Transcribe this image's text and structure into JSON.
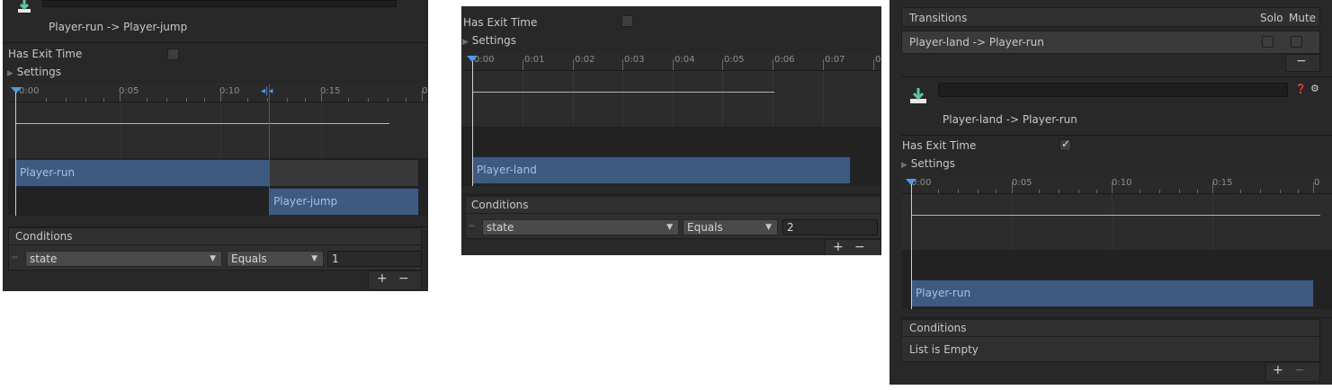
{
  "panel1": {
    "title": "Player-run -> Player-jump",
    "has_exit_time_label": "Has Exit Time",
    "settings_label": "Settings",
    "ticks": [
      "0:00",
      "0:05",
      "0:10",
      "0:15",
      "0"
    ],
    "bar1_label": "Player-run",
    "bar2_label": "Player-jump",
    "conditions_label": "Conditions",
    "condition_param": "state",
    "condition_op": "Equals",
    "condition_value": "1",
    "plus": "+",
    "minus": "−"
  },
  "panel2": {
    "has_exit_time_label": "Has Exit Time",
    "settings_label": "Settings",
    "ticks": [
      "0:00",
      "0:01",
      "0:02",
      "0:03",
      "0:04",
      "0:05",
      "0:06",
      "0:07",
      "0"
    ],
    "bar_label": "Player-land",
    "conditions_label": "Conditions",
    "condition_param": "state",
    "condition_op": "Equals",
    "condition_value": "2",
    "plus": "+",
    "minus": "−"
  },
  "panel3": {
    "transitions_header": "Transitions",
    "solo_label": "Solo",
    "mute_label": "Mute",
    "transition_row": "Player-land -> Player-run",
    "minus_small": "−",
    "title": "Player-land -> Player-run",
    "has_exit_time_label": "Has Exit Time",
    "has_exit_time_check": "✓",
    "settings_label": "Settings",
    "ticks": [
      "0:00",
      "0:05",
      "0:10",
      "0:15",
      "0"
    ],
    "bar_label": "Player-run",
    "conditions_label": "Conditions",
    "list_empty": "List is Empty",
    "plus": "+",
    "minus": "−"
  }
}
